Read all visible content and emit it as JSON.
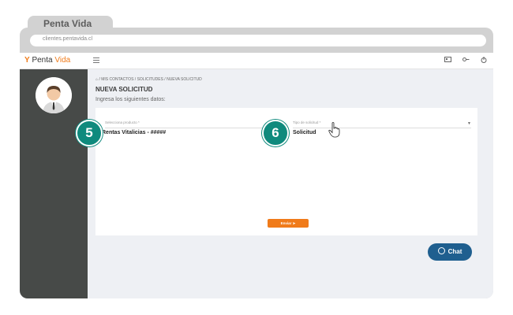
{
  "browser": {
    "tab_title": "Penta Vida",
    "url": "clientes.pentavida.cl"
  },
  "header": {
    "logo_text": "Penta",
    "logo_text_accent": "Vida",
    "logo_symbol": "Y",
    "menu_icon": "menu-icon",
    "icons": [
      "id-card-icon",
      "key-icon",
      "power-icon"
    ]
  },
  "main": {
    "breadcrumb": "/ MIS CONTACTOS / SOLICITUDES / NUEVA SOLICITUD",
    "title": "NUEVA SOLICITUD",
    "subtitle": "Ingresa los siguientes datos:",
    "fields": [
      {
        "label": "Selecciona producto *",
        "value": "Rentas Vitalicias - #####",
        "step": "5"
      },
      {
        "label": "Tipo de solicitud *",
        "value": "Solicitud",
        "step": "6"
      }
    ],
    "send_label": "Enviar"
  },
  "chat": {
    "label": "Chat"
  },
  "colors": {
    "accent": "#f07b1a",
    "badge": "#0f8a7d",
    "sidebar": "#474a48",
    "chat": "#1f5f8f"
  }
}
